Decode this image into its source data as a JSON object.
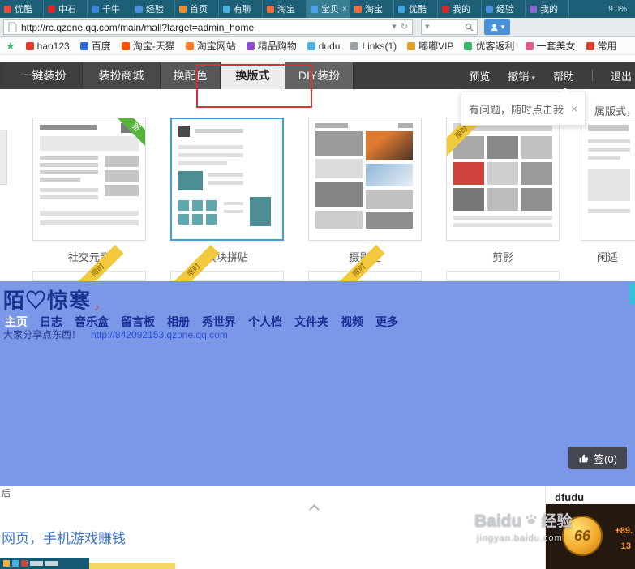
{
  "colors": {
    "accent_blue": "#3d9fe0",
    "qzone_blue": "#7b97e8",
    "ribbon_yellow": "#f2c93c",
    "badge_green": "#57b33a"
  },
  "browser": {
    "tabs": [
      "优酷",
      "中石",
      "千牛",
      "经验",
      "首页",
      "有聊",
      "淘宝",
      "宝贝",
      "淘宝",
      "优酷",
      "我的",
      "经验",
      "我的"
    ],
    "active_tab_close": "×",
    "tab_progress": "9.0%",
    "url": "http://rc.qzone.qq.com/main/mall?target=admin_home",
    "bookmarks": [
      "hao123",
      "百度",
      "淘宝-天猫",
      "淘宝网站",
      "精品购物",
      "dudu",
      "Links(1)",
      "嘟嘟VIP",
      "优客返利",
      "一套美女",
      "常用"
    ]
  },
  "qz_toolbar": {
    "tabs": [
      "一键装扮",
      "装扮商城",
      "换配色",
      "换版式",
      "DIY装扮"
    ],
    "preview": "预览",
    "undo": "撤销",
    "help": "帮助",
    "exit": "退出"
  },
  "tooltip": {
    "text": "有问题，随时点击我",
    "close": "×"
  },
  "fragment_text": "属版式，空",
  "cards": {
    "ribbon_label": "限时",
    "new_badge": "新",
    "items": [
      "社交元素",
      "模块拼贴",
      "摄影控",
      "剪影",
      "闲适"
    ]
  },
  "qzone": {
    "username": "陌♡惊寒",
    "nav": [
      "主页",
      "日志",
      "音乐盒",
      "留言板",
      "相册",
      "秀世界",
      "个人档",
      "文件夹",
      "视频",
      "更多"
    ],
    "motto": "大家分享点东西！",
    "homepage_url": "http://842092153.qzone.qq.com",
    "sign_label": "签(0)"
  },
  "bottom": {
    "friend": "dfudu",
    "ad_text": "网页，手机游戏赚钱",
    "corner_glyph": "后",
    "watermark_brand": "Baidu",
    "watermark_product": "经验",
    "watermark_url": "jingyan.baidu.com",
    "coin_text": "66",
    "gain_top": "+89.",
    "gain_bottom": "13"
  }
}
